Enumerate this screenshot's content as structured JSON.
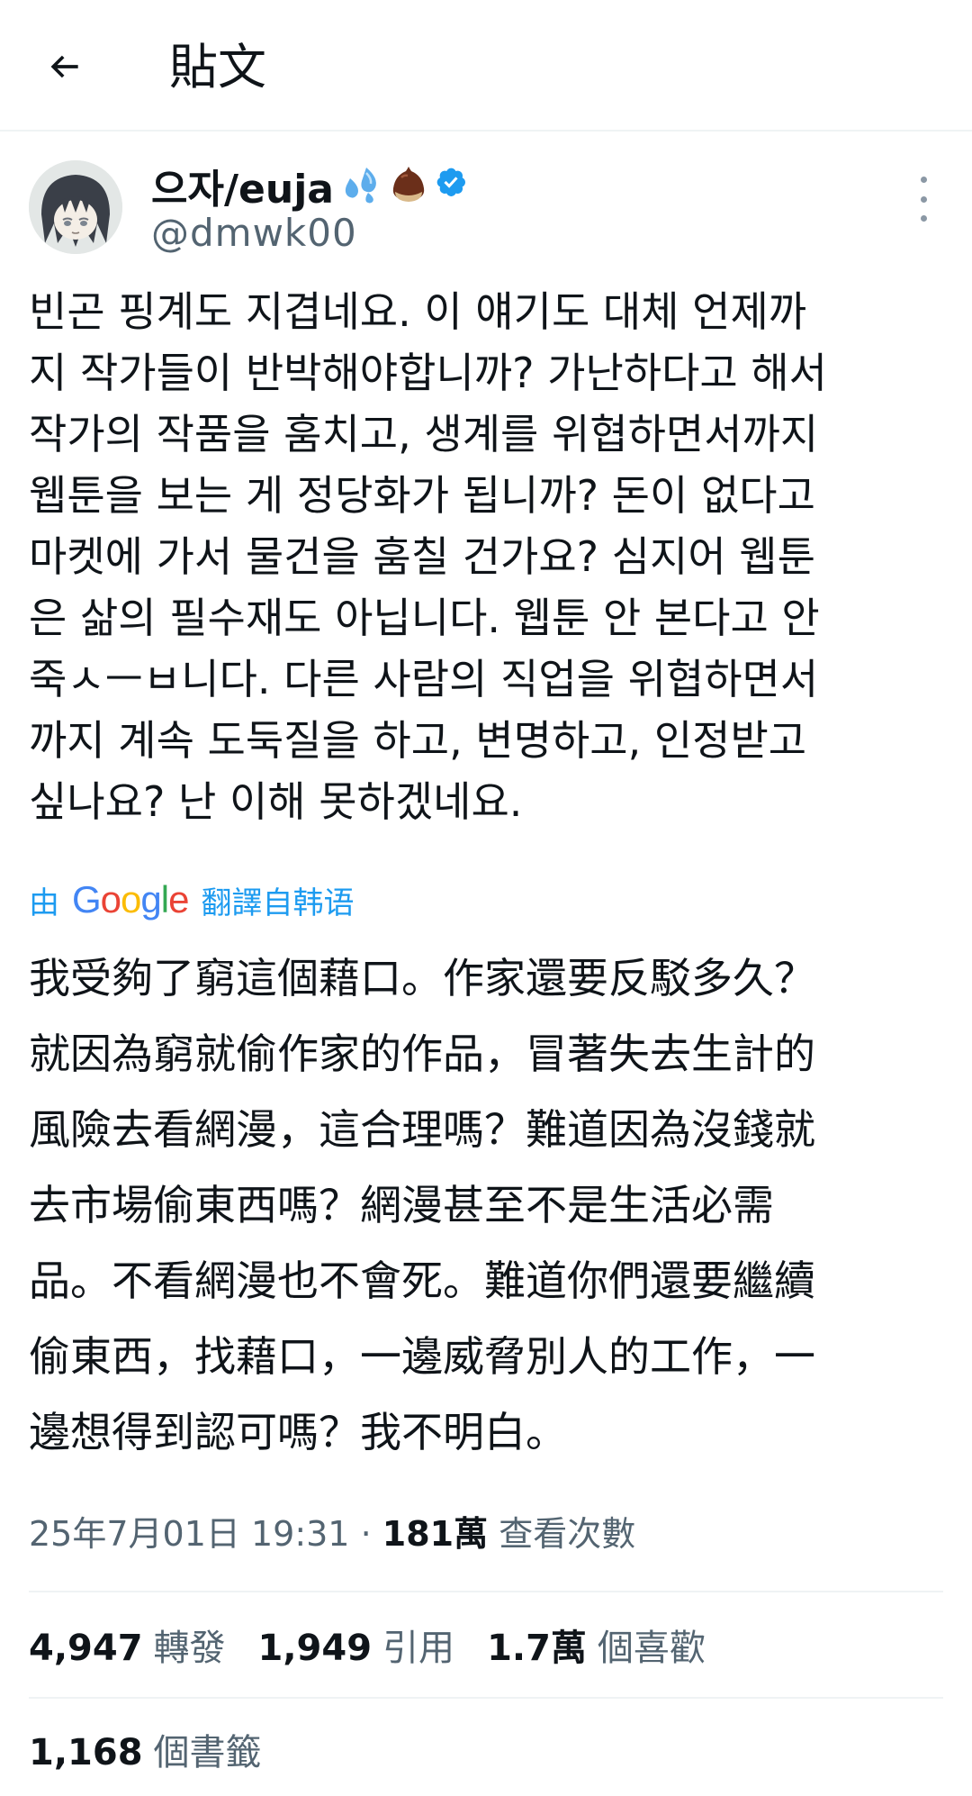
{
  "header": {
    "title": "貼文"
  },
  "author": {
    "display_name": "으자/euja",
    "handle": "@dmwk00",
    "verified_color": "#1d9bf0"
  },
  "tweet": {
    "original_text": "빈곤 핑계도 지겹네요. 이 얘기도 대체 언제까\n지 작가들이 반박해야합니까? 가난하다고 해서\n작가의 작품을 훔치고, 생계를 위협하면서까지\n웹툰을 보는 게 정당화가 됩니까? 돈이 없다고\n마켓에 가서 물건을 훔칠 건가요? 심지어 웹툰\n은 삶의 필수재도 아닙니다. 웹툰 안 본다고 안\n죽ㅅㅡㅂ니다. 다른 사람의 직업을 위협하면서\n까지 계속 도둑질을 하고, 변명하고, 인정받고\n싶나요? 난 이해 못하겠네요.",
    "translation_by": "由",
    "translation_brand": "Google",
    "translation_source": "翻譯自韩语",
    "translated_text": "我受夠了窮這個藉口。作家還要反駁多久？\n就因為窮就偷作家的作品，冒著失去生計的\n風險去看網漫，這合理嗎？難道因為沒錢就\n去市場偷東西嗎？網漫甚至不是生活必需\n品。不看網漫也不會死。難道你們還要繼續\n偷東西，找藉口，一邊威脅別人的工作，一\n邊想得到認可嗎？我不明白。"
  },
  "meta": {
    "timestamp": "25年7月01日 19:31",
    "separator": "·",
    "views_count": "181萬",
    "views_label": "查看次數"
  },
  "stats": {
    "retweets_count": "4,947",
    "retweets_label": "轉發",
    "quotes_count": "1,949",
    "quotes_label": "引用",
    "likes_count": "1.7萬",
    "likes_label": "個喜歡",
    "bookmarks_count": "1,168",
    "bookmarks_label": "個書籤"
  },
  "icons": {
    "back": "arrow-left-icon",
    "more": "more-vertical-icon",
    "verified": "verified-badge-icon",
    "sweat": "sweat-droplets-emoji",
    "chestnut": "chestnut-emoji"
  }
}
